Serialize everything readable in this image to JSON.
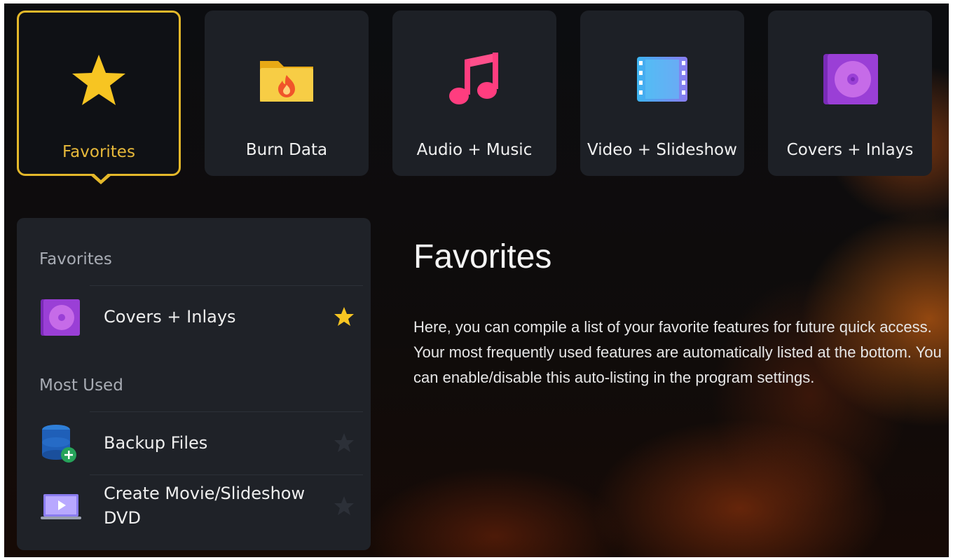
{
  "tiles": [
    {
      "label": "Favorites",
      "icon": "star-icon",
      "active": true
    },
    {
      "label": "Burn Data",
      "icon": "folder-fire-icon"
    },
    {
      "label": "Audio + Music",
      "icon": "music-note-icon"
    },
    {
      "label": "Video + Slideshow",
      "icon": "film-strip-icon"
    },
    {
      "label": "Covers + Inlays",
      "icon": "disc-cover-icon"
    }
  ],
  "panel": {
    "favorites_heading": "Favorites",
    "favorites": [
      {
        "label": "Covers + Inlays",
        "icon": "disc-cover-icon",
        "favorited": true
      }
    ],
    "most_used_heading": "Most Used",
    "most_used": [
      {
        "label": "Backup Files",
        "icon": "database-add-icon",
        "favorited": false
      },
      {
        "label": "Create Movie/Slideshow DVD",
        "icon": "laptop-play-icon",
        "favorited": false
      }
    ]
  },
  "detail": {
    "title": "Favorites",
    "description": "Here, you can compile a list of your favorite features for future quick access. Your most frequently used features are automatically listed at the bottom. You can enable/disable this auto-listing in the program settings."
  },
  "colors": {
    "accent": "#e4b82a",
    "tile_bg": "#1d2026",
    "panel_bg": "#1f2228"
  }
}
